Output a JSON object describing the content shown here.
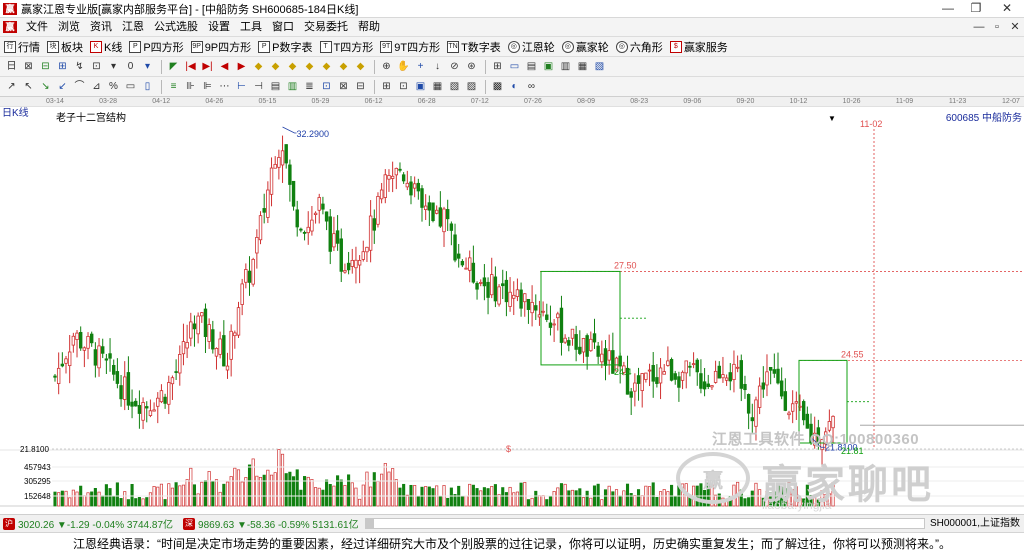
{
  "window": {
    "title": "赢家江恩专业版[赢家内部服务平台] - [中船防务  SH600685-184日K线]",
    "controls": {
      "minimize": "—",
      "restore": "❐",
      "close": "✕"
    }
  },
  "menu": {
    "items": [
      "文件",
      "浏览",
      "资讯",
      "江恩",
      "公式选股",
      "设置",
      "工具",
      "窗口",
      "交易委托",
      "帮助"
    ],
    "right_controls": [
      "—",
      "▫",
      "✕"
    ]
  },
  "toolbar1": {
    "items": [
      {
        "icon": "行",
        "label": "行情"
      },
      {
        "icon": "块",
        "label": "板块"
      },
      {
        "icon": "K",
        "label": "K线"
      },
      {
        "icon": "P",
        "label": "P四方形"
      },
      {
        "icon": "9P",
        "label": "9P四方形"
      },
      {
        "icon": "P",
        "label": "P数字表"
      },
      {
        "icon": "T",
        "label": "T四方形"
      },
      {
        "icon": "9T",
        "label": "9T四方形"
      },
      {
        "icon": "TN",
        "label": "T数字表"
      },
      {
        "icon": "◎",
        "label": "江恩轮"
      },
      {
        "icon": "◎",
        "label": "赢家轮"
      },
      {
        "icon": "◎",
        "label": "六角形"
      },
      {
        "icon": "$",
        "label": "赢家服务"
      }
    ]
  },
  "toolbar2": {
    "icons": [
      "日",
      "⊠",
      "⊟",
      "⊞",
      "↯",
      "⊡",
      "▾",
      "0",
      "▾",
      "◤",
      "|◀",
      "▶|",
      "◀",
      "▶",
      "◆",
      "◆",
      "◆",
      "◆",
      "◆",
      "◆",
      "◆",
      "⊕",
      "✋",
      "+",
      "↓",
      "⊘",
      "⊛",
      "⊞",
      "▭",
      "▤",
      "▣",
      "▥",
      "▦",
      "▧"
    ]
  },
  "toolbar3": {
    "icons": [
      "↗",
      "↖",
      "↘",
      "↙",
      "⌒",
      "⊿",
      "%",
      "▭",
      "▯",
      "≡",
      "⊪",
      "⊫",
      "⋯",
      "⊢",
      "⊣",
      "▤",
      "▥",
      "≣",
      "⊡",
      "⊠",
      "⊟",
      "⊞",
      "⊡",
      "▣",
      "▦",
      "▧",
      "▨",
      "▩",
      "◐",
      "∞"
    ]
  },
  "date_axis": {
    "ticks": [
      "03-14",
      "03-28",
      "04-12",
      "04-26",
      "05-15",
      "05-29",
      "06-12",
      "06-28",
      "07-12",
      "07-26",
      "08-09",
      "08-23",
      "09-06",
      "09-20",
      "10-12",
      "10-26",
      "11-09",
      "11-23",
      "12-07"
    ]
  },
  "chart_header": {
    "period": "日K线",
    "title": "老子十二宫结构",
    "stock_code": "600685  中船防务",
    "dropdown_arrow": "▼"
  },
  "chart_data": {
    "type": "candlestick",
    "stock": "600685 中船防务",
    "title": "老子十二宫结构",
    "date_ticks": [
      "03-14",
      "03-28",
      "04-12",
      "04-26",
      "05-15",
      "05-29",
      "06-12",
      "06-28",
      "07-12",
      "07-26",
      "08-09",
      "08-23",
      "09-06",
      "09-20",
      "10-12",
      "10-26",
      "11-09",
      "11-23",
      "12-07"
    ],
    "price_annotations": {
      "high": "32.2900",
      "low": "21.8100"
    },
    "level_labels": [
      "27.50",
      "24.4",
      "24.55",
      "21.81"
    ],
    "date_marker": "11-02",
    "dollar_marker": "$",
    "left_price_label": "21.8100",
    "volume_ticks": [
      "457943",
      "305295",
      "152648"
    ],
    "pivots": [
      [
        0,
        24.0
      ],
      [
        5,
        25.4
      ],
      [
        10,
        24.9
      ],
      [
        15,
        24.2
      ],
      [
        20,
        23.4
      ],
      [
        25,
        23.1
      ],
      [
        30,
        23.5
      ],
      [
        34,
        24.4
      ],
      [
        38,
        26.0
      ],
      [
        43,
        25.3
      ],
      [
        47,
        24.5
      ],
      [
        50,
        26.5
      ],
      [
        54,
        27.8
      ],
      [
        57,
        29.6
      ],
      [
        60,
        31.5
      ],
      [
        62,
        31.8
      ],
      [
        65,
        29.5
      ],
      [
        69,
        29.0
      ],
      [
        72,
        29.7
      ],
      [
        75,
        28.6
      ],
      [
        78,
        27.8
      ],
      [
        81,
        28.1
      ],
      [
        84,
        28.4
      ],
      [
        87,
        29.2
      ],
      [
        90,
        30.3
      ],
      [
        94,
        30.9
      ],
      [
        97,
        30.4
      ],
      [
        100,
        29.5
      ],
      [
        103,
        29.0
      ],
      [
        106,
        29.3
      ],
      [
        110,
        28.0
      ],
      [
        114,
        27.4
      ],
      [
        118,
        27.0
      ],
      [
        122,
        26.9
      ],
      [
        126,
        26.6
      ],
      [
        130,
        26.5
      ],
      [
        135,
        25.9
      ],
      [
        140,
        25.3
      ],
      [
        145,
        24.9
      ],
      [
        150,
        24.6
      ],
      [
        155,
        24.0
      ],
      [
        158,
        23.6
      ],
      [
        162,
        24.0
      ],
      [
        166,
        24.3
      ],
      [
        170,
        24.1
      ],
      [
        174,
        24.1
      ],
      [
        178,
        23.8
      ],
      [
        182,
        24.4
      ],
      [
        186,
        23.9
      ],
      [
        190,
        22.9
      ],
      [
        194,
        24.2
      ],
      [
        198,
        23.5
      ],
      [
        202,
        22.8
      ],
      [
        206,
        22.0
      ],
      [
        209,
        22.2
      ],
      [
        212,
        22.5
      ]
    ]
  },
  "watermark": {
    "software": "江恩工具软件 QQ:100800360",
    "logo": "赢",
    "brand": "赢家聊吧",
    "url": "liaoba.yingjia"
  },
  "statusbar": {
    "sh_icon": "沪",
    "sh_quote": "3020.26 ▼-1.29 -0.04% 3744.87亿",
    "sz_icon": "深",
    "sz_quote": "9869.63 ▼-58.36 -0.59% 5131.61亿",
    "index_label": "SH000001,上证指数"
  },
  "quote": {
    "text": "江恩经典语录：“时间是决定市场走势的重要因素，经过详细研究大市及个别股票的过往记录，你将可以证明，历史确实重复发生；而了解过往，你将可以预测将来。”。"
  },
  "colors": {
    "up": "#d03030",
    "down": "#108010",
    "level": "#e05050",
    "box": "#10a010",
    "annotation_blue": "#1f3fa8"
  }
}
